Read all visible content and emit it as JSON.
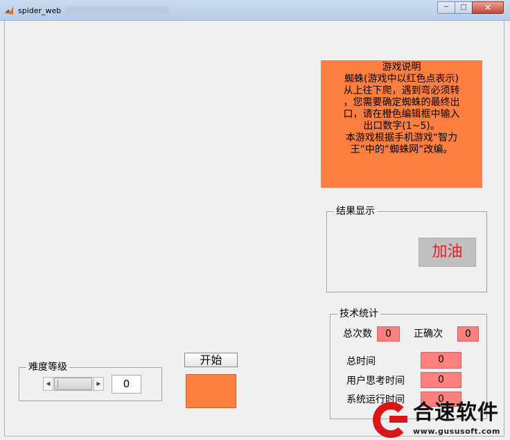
{
  "window": {
    "title": "spider_web",
    "minimize": "─",
    "maximize": "□",
    "close": "✕"
  },
  "instructions": {
    "lines": [
      "游戏说明",
      "蜘蛛(游戏中以红色点表示)",
      "从上往下爬，遇到弯必须转",
      "，您需要确定蜘蛛的最终出",
      "口，请在橙色编辑框中输入",
      "出口数字(1~5)。",
      "本游戏根据手机游戏“智力",
      "王”中的“蜘蛛网”改编。"
    ]
  },
  "result": {
    "label": "结果显示",
    "cheer": "加油"
  },
  "stats": {
    "label": "技术统计",
    "total_label": "总次数",
    "total_value": "0",
    "correct_label": "正确次",
    "correct_value": "0",
    "total_time_label": "总时间",
    "total_time_value": "0",
    "think_time_label": "用户思考时间",
    "think_time_value": "0",
    "run_time_label": "系统运行时间",
    "run_time_value": "0"
  },
  "difficulty": {
    "label": "难度等级",
    "value": "0",
    "arrow_left": "◀",
    "arrow_right": "▶"
  },
  "controls": {
    "start_label": "开始"
  },
  "watermark": {
    "brand": "合速软件",
    "url": "www.gususoft.com"
  },
  "colors": {
    "orange": "#ff7f40",
    "stat_pink": "#ff7f7f",
    "cheer_red": "#e82020"
  }
}
